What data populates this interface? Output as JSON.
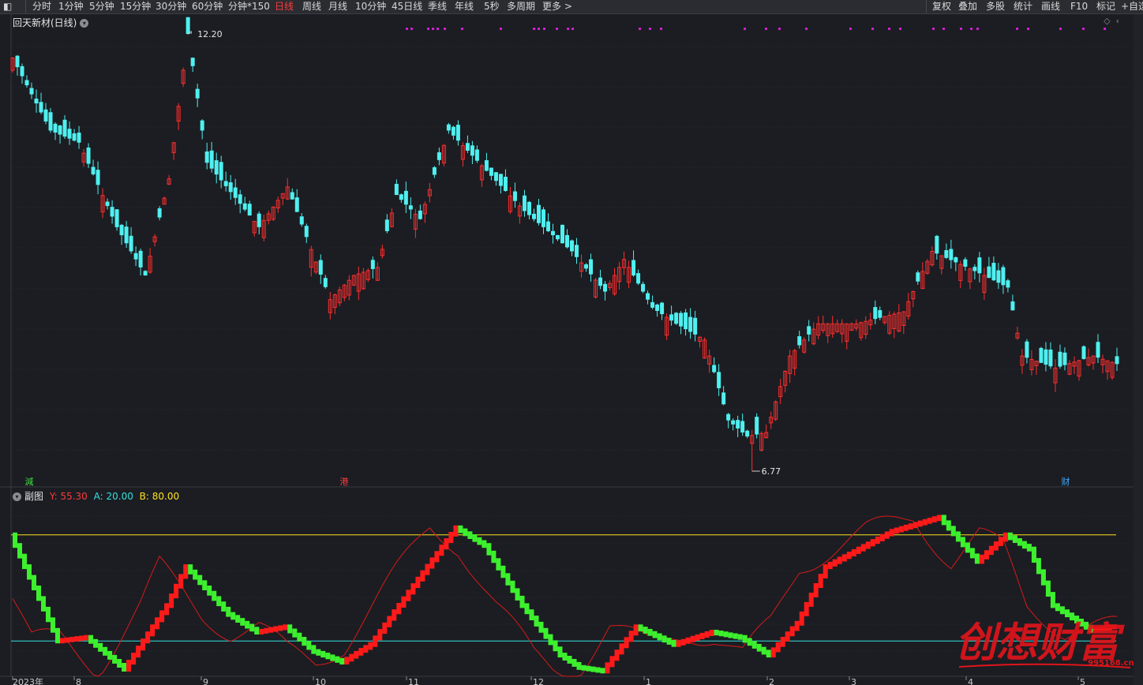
{
  "toolbar": {
    "periods": [
      "分时",
      "1分钟",
      "5分钟",
      "15分钟",
      "30分钟",
      "60分钟",
      "分钟*150",
      "日线",
      "周线",
      "月线",
      "10分钟",
      "45日线",
      "季线",
      "年线",
      "5秒",
      "多周期",
      "更多 >"
    ],
    "active": "日线",
    "right_items": [
      "复权",
      "叠加",
      "多股",
      "统计",
      "画线",
      "F10",
      "标记",
      "+自选"
    ]
  },
  "main": {
    "stock_title": "回天新材(日线)",
    "high_label": "12.20",
    "low_label": "6.77",
    "badges": [
      {
        "text": "減",
        "color": "#3ddc3d"
      },
      {
        "text": "港",
        "color": "#ff3b3b"
      },
      {
        "text": "财",
        "color": "#3fa9ff"
      }
    ],
    "corner_icons": [
      "diamond-icon",
      "chevron-left-icon"
    ]
  },
  "sub": {
    "title": "副图",
    "y_label": "Y: 55.30",
    "a_label": "A: 20.00",
    "b_label": "B: 80.00",
    "y_color": "#ff3b3b",
    "a_color": "#35e0e0",
    "b_color": "#ffe21f"
  },
  "x_axis": {
    "labels": [
      "2023年",
      "8",
      "9",
      "10",
      "11",
      "12",
      "1",
      "2",
      "3",
      "4",
      "5"
    ]
  },
  "watermark": {
    "text": "创想财富",
    "url": "995168.cn",
    "color": "#e0141b"
  },
  "chart_data": {
    "type": "candlestick",
    "series_high": 12.2,
    "series_low": 6.77,
    "indicator": {
      "name": "Y",
      "value": 55.3,
      "levels": {
        "A": 20.0,
        "B": 80.0
      }
    }
  },
  "colors": {
    "up": "#ff2e2e",
    "down": "#4ff0f0",
    "bg": "#1b1d22",
    "grid": "#2c2e34"
  }
}
